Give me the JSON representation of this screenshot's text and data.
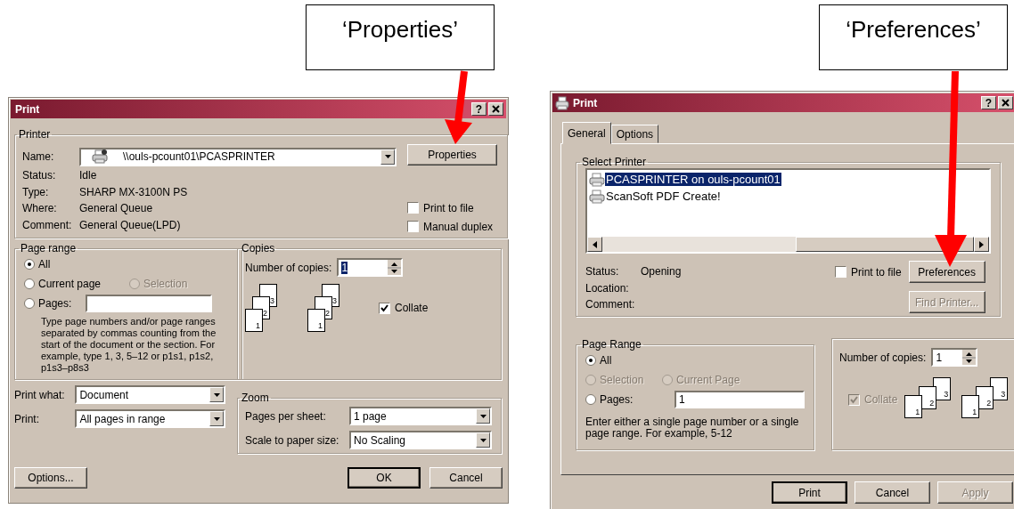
{
  "callouts": [
    {
      "text": "‘Properties’"
    },
    {
      "text": "‘Preferences’"
    }
  ],
  "left_dialog": {
    "title": "Print",
    "help": "?",
    "printer": {
      "title": "Printer",
      "name_label": "Name:",
      "name_value": "\\\\ouls-pcount01\\PCASPRINTER",
      "properties_button": "Properties",
      "info": [
        {
          "label": "Status:",
          "value": "Idle"
        },
        {
          "label": "Type:",
          "value": "SHARP MX-3100N PS"
        },
        {
          "label": "Where:",
          "value": "General Queue"
        },
        {
          "label": "Comment:",
          "value": "General Queue(LPD)"
        }
      ],
      "options": [
        {
          "label": "Print to file",
          "checked": false
        },
        {
          "label": "Manual duplex",
          "checked": false
        }
      ]
    },
    "page_range": {
      "title": "Page range",
      "options": [
        {
          "label": "All",
          "selected": true,
          "disabled": false
        },
        {
          "label": "Current page",
          "selected": false,
          "disabled": false
        },
        {
          "label": "Selection",
          "selected": false,
          "disabled": true
        },
        {
          "label": "Pages:",
          "selected": false,
          "disabled": false
        }
      ],
      "hint": "Type page numbers and/or page ranges separated by commas counting from the start of the document or the section. For example, type 1, 3, 5–12 or p1s1, p1s2, p1s3–p8s3"
    },
    "copies": {
      "title": "Copies",
      "label": "Number of copies:",
      "value": "1",
      "value_highlighted": true,
      "stacks": [
        [
          "1",
          "2",
          "3"
        ],
        [
          "1",
          "2",
          "3"
        ]
      ],
      "collate": {
        "label": "Collate",
        "checked": true,
        "disabled": false
      }
    },
    "print_what": {
      "label": "Print what:",
      "value": "Document"
    },
    "print": {
      "label": "Print:",
      "value": "All pages in range"
    },
    "zoom": {
      "title": "Zoom",
      "rows": [
        {
          "label": "Pages per sheet:",
          "value": "1 page"
        },
        {
          "label": "Scale to paper size:",
          "value": "No Scaling"
        }
      ]
    },
    "options_button": "Options...",
    "buttons": [
      {
        "label": "OK",
        "default": true,
        "disabled": false
      },
      {
        "label": "Cancel",
        "default": false,
        "disabled": false
      }
    ]
  },
  "right_dialog": {
    "title": "Print",
    "help": "?",
    "tabs": [
      {
        "label": "General",
        "selected": true
      },
      {
        "label": "Options",
        "selected": false
      }
    ],
    "select_printer": {
      "title": "Select Printer",
      "printers": [
        {
          "name": "PCASPRINTER on ouls-pcount01",
          "selected": true
        },
        {
          "name": "ScanSoft PDF Create!",
          "selected": false
        }
      ],
      "info": [
        {
          "label": "Status:",
          "value": "Opening"
        },
        {
          "label": "Location:"
        },
        {
          "label": "Comment:"
        }
      ],
      "print_to_file": {
        "label": "Print to file",
        "checked": false
      },
      "buttons": [
        {
          "label": "Preferences",
          "disabled": false
        },
        {
          "label": "Find Printer...",
          "disabled": true
        }
      ]
    },
    "page_range": {
      "title": "Page Range",
      "options": [
        {
          "label": "All",
          "selected": true,
          "disabled": false
        },
        {
          "label": "Selection",
          "selected": false,
          "disabled": true
        },
        {
          "label": "Current Page",
          "selected": false,
          "disabled": true
        },
        {
          "label": "Pages:",
          "selected": false,
          "disabled": false
        }
      ],
      "pages_value": "1",
      "hint": "Enter either a single page number or a single page range.  For example, 5-12"
    },
    "copies": {
      "label": "Number of copies:",
      "value": "1",
      "stacks": [
        [
          "1",
          "2",
          "3"
        ],
        [
          "1",
          "2",
          "3"
        ]
      ],
      "collate": {
        "label": "Collate",
        "checked": true,
        "disabled": true
      }
    },
    "buttons": [
      {
        "label": "Print",
        "default": true,
        "disabled": false
      },
      {
        "label": "Cancel",
        "default": false,
        "disabled": false
      },
      {
        "label": "Apply",
        "default": false,
        "disabled": true
      }
    ]
  }
}
